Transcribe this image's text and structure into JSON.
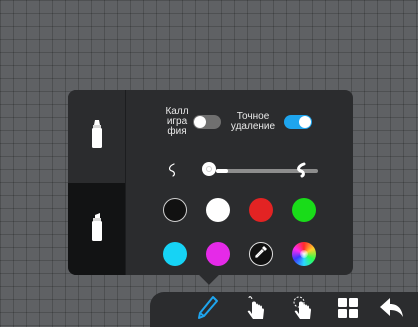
{
  "pen_panel": {
    "calligraphy_label": "Каллиграфия",
    "precise_erase_label": "Точное удаление",
    "calligraphy_enabled": false,
    "precise_erase_enabled": true,
    "stroke_width_level": 0.08,
    "colors": {
      "black": "#111111",
      "white": "#ffffff",
      "red": "#e32323",
      "green": "#19dc19",
      "cyan": "#16d3f5",
      "magenta": "#e52ae8"
    },
    "side_tools": [
      "marker-icon",
      "highlighter-icon"
    ],
    "selected_side_tool": "highlighter-icon"
  },
  "toolbar": {
    "items": [
      "pen-icon",
      "tap-select-icon",
      "gesture-icon",
      "apps-grid-icon",
      "undo-icon"
    ],
    "active": "pen-icon",
    "accent": "#1ea5ee"
  }
}
